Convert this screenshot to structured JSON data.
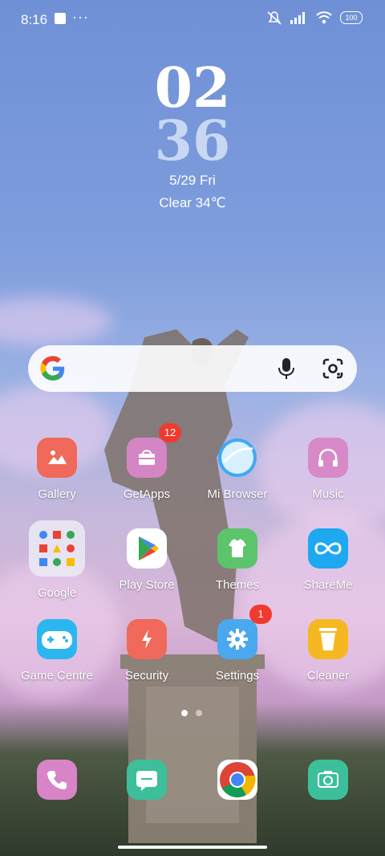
{
  "status": {
    "time": "8:16",
    "battery": "100"
  },
  "clock": {
    "hour": "02",
    "minute": "36",
    "date": "5/29 Fri",
    "weather": "Clear 34℃"
  },
  "search": {
    "google_icon": "google-g-icon",
    "mic_icon": "microphone-icon",
    "lens_icon": "google-lens-icon"
  },
  "apps": [
    {
      "label": "Gallery",
      "icon": "gallery-icon",
      "color": "#f0695a",
      "badge": ""
    },
    {
      "label": "GetApps",
      "icon": "getapps-icon",
      "color": "#d486c4",
      "badge": "12"
    },
    {
      "label": "Mi Browser",
      "icon": "mi-browser-icon",
      "color": "#5ab8f0",
      "badge": ""
    },
    {
      "label": "Music",
      "icon": "music-icon",
      "color": "#d88ac8",
      "badge": ""
    },
    {
      "label": "Google",
      "icon": "google-folder-icon",
      "color": "#e8eaf2",
      "badge": ""
    },
    {
      "label": "Play Store",
      "icon": "play-store-icon",
      "color": "#ffffff",
      "badge": ""
    },
    {
      "label": "Themes",
      "icon": "themes-icon",
      "color": "#5cc46a",
      "badge": ""
    },
    {
      "label": "ShareMe",
      "icon": "shareme-icon",
      "color": "#1ea8f0",
      "badge": ""
    },
    {
      "label": "Game Centre",
      "icon": "game-centre-icon",
      "color": "#2cb6f0",
      "badge": ""
    },
    {
      "label": "Security",
      "icon": "security-icon",
      "color": "#f0695a",
      "badge": ""
    },
    {
      "label": "Settings",
      "icon": "settings-icon",
      "color": "#4aa8ee",
      "badge": "1"
    },
    {
      "label": "Cleaner",
      "icon": "cleaner-icon",
      "color": "#f6b820",
      "badge": ""
    }
  ],
  "dock": [
    {
      "icon": "phone-icon",
      "color": "#d884c6"
    },
    {
      "icon": "messaging-icon",
      "color": "#3cbf9a"
    },
    {
      "icon": "chrome-icon",
      "color": "#ffffff"
    },
    {
      "icon": "camera-icon",
      "color": "#3cbf9a"
    }
  ]
}
